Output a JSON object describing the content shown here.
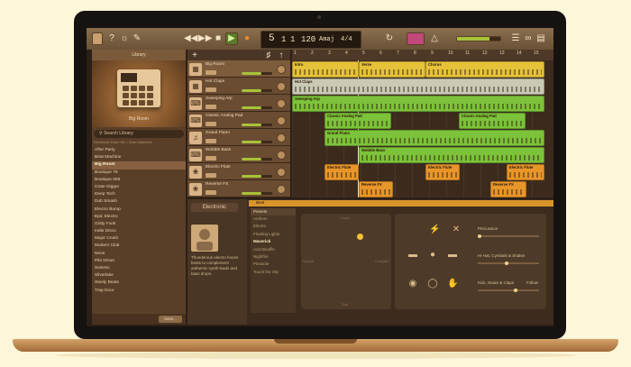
{
  "app": {
    "library_title": "Library",
    "library_art_label": "Big Room",
    "search_placeholder": "Search Library",
    "breadcrumb": "Electronic Drum Kit  >  Drum Machine"
  },
  "library_items": [
    {
      "label": "After Party"
    },
    {
      "label": "Beat Machine"
    },
    {
      "label": "Big Room"
    },
    {
      "label": "Boutique 78"
    },
    {
      "label": "Boutique 808"
    },
    {
      "label": "Crate Digger"
    },
    {
      "label": "Deep Tech"
    },
    {
      "label": "Dub Smash"
    },
    {
      "label": "Electro Bump"
    },
    {
      "label": "Epic Electro"
    },
    {
      "label": "Gritty Funk"
    },
    {
      "label": "Indie Disco"
    },
    {
      "label": "Major Crush"
    },
    {
      "label": "Modern Club"
    },
    {
      "label": "Neon"
    },
    {
      "label": "Pile Driver"
    },
    {
      "label": "Seismic"
    },
    {
      "label": "Silverlake"
    },
    {
      "label": "Steely Beats"
    },
    {
      "label": "Trap Door"
    }
  ],
  "library_selected": "Big Room",
  "library_save_label": "Save...",
  "transport": {
    "bar": "5",
    "beat": "1",
    "sub": "1",
    "tempo": "120",
    "key": "Amaj",
    "time_sig": "4/4"
  },
  "tracks": [
    {
      "name": "Big Room",
      "icon": "drum-machine-icon"
    },
    {
      "name": "Hot Claps",
      "icon": "drum-machine-icon"
    },
    {
      "name": "Sweeping Arp",
      "icon": "keyboard-icon"
    },
    {
      "name": "Classic Analog Pad",
      "icon": "keyboard-icon"
    },
    {
      "name": "Grand Piano",
      "icon": "piano-icon"
    },
    {
      "name": "Wobble Bass",
      "icon": "keyboard-icon"
    },
    {
      "name": "Electric Flute",
      "icon": "audio-icon"
    },
    {
      "name": "Reverse FX",
      "icon": "audio-icon"
    }
  ],
  "ruler_ticks": [
    "1",
    "2",
    "3",
    "4",
    "5",
    "6",
    "7",
    "8",
    "9",
    "10",
    "11",
    "12",
    "13",
    "14",
    "15"
  ],
  "regions": {
    "r1": "Intro",
    "r2": "Verse",
    "r3": "Chorus",
    "r4": "Hot Claps",
    "r5": "Sweeping Arp",
    "r6": "Classic Analog Pad",
    "r7": "Classic Analog Pad",
    "r8": "Grand Piano",
    "r9": "Wobble Bass",
    "r10": "Electric Flute",
    "r11": "Electric Flute",
    "r12": "Electric Flute",
    "r13": "Reverse FX",
    "r14": "Reverse FX"
  },
  "editor": {
    "header": "Beat",
    "category": "Electronic",
    "description": "Thunderous electro house beats to complement anthemic synth leads and bass drops.",
    "presets_title": "Presets",
    "presets": [
      {
        "label": "Anthem"
      },
      {
        "label": "Electro"
      },
      {
        "label": "Floating Lights"
      },
      {
        "label": "Maverick"
      },
      {
        "label": "Acid Bouffin"
      },
      {
        "label": "Nightfire"
      },
      {
        "label": "Pinnacle"
      },
      {
        "label": "Touch the Sky"
      }
    ],
    "xy_loud": "Loud",
    "xy_soft": "Soft",
    "xy_simple": "Simple",
    "xy_complex": "Complex",
    "slider1_label": "Percussion",
    "slider2_label": "Hi-Hat, Cymbals & Shaker",
    "slider3_label": "Kick, Snare & Claps",
    "fills_label": "Follow"
  },
  "colors": {
    "green_region": "#7cc23a",
    "yellow_region": "#e6c23a",
    "orange_region": "#e8962a",
    "accent": "#f4c23a"
  }
}
